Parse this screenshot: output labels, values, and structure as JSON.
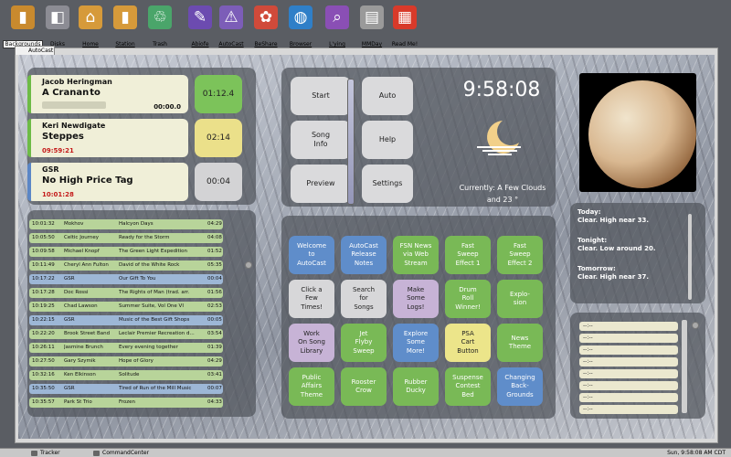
{
  "desktop_icons": [
    {
      "label": "Backgrounds",
      "icon": "folder-icon",
      "color": "#c98a2e",
      "selected": true
    },
    {
      "label": "Disks",
      "icon": "disks-icon",
      "color": "#8c8c94"
    },
    {
      "label": "Home",
      "icon": "home-folder-icon",
      "color": "#d69a3a",
      "underline": true
    },
    {
      "label": "Station",
      "icon": "folder-icon",
      "color": "#d69a3a",
      "underline": true
    },
    {
      "label": "Trash",
      "icon": "trash-icon",
      "color": "#4aa56a"
    },
    {
      "label": "Abiofe",
      "icon": "paint-icon",
      "color": "#6c4bb0",
      "underline": true
    },
    {
      "label": "AutoCast",
      "icon": "broadcast-icon",
      "color": "#7c5db8",
      "underline": true
    },
    {
      "label": "BeShare",
      "icon": "flower-icon",
      "color": "#d04a3a",
      "underline": true
    },
    {
      "label": "Browser",
      "icon": "globe-icon",
      "color": "#2f7fc8",
      "underline": true
    },
    {
      "label": "L'ying",
      "icon": "magnifier-icon",
      "color": "#8a4fb5",
      "underline": true
    },
    {
      "label": "MMDay",
      "icon": "document-icon",
      "color": "#9a9a9a",
      "underline": true
    },
    {
      "label": "Read Me!",
      "icon": "pdf-icon",
      "color": "#d83a2a"
    }
  ],
  "window": {
    "tab_title": "AutoCast"
  },
  "now_playing": [
    {
      "artist": "Jacob Heringman",
      "title": "A Cranan to",
      "time": "00:00.0",
      "countdown": "01:12.4",
      "countdown_color": "#7cc35a",
      "time_red": false,
      "bar_color": "#6dbb46"
    },
    {
      "artist": "Keri Newdigate",
      "title": "Steppes",
      "time": "09:59:21",
      "countdown": "02:14",
      "countdown_color": "#ebe08a",
      "time_red": true,
      "bar_color": "#6dbb46"
    },
    {
      "artist": "GSR",
      "title": "No High Price Tag",
      "time": "10:01:28",
      "countdown": "00:04",
      "countdown_color": "#d3d3d5",
      "time_red": true,
      "bar_color": "#5b86c6"
    }
  ],
  "playlist": [
    {
      "time": "10:01:32",
      "artist": "Mokhov",
      "title": "Halcyon Days",
      "dur": "04:29",
      "color": "green"
    },
    {
      "time": "10:05:50",
      "artist": "Celtic Journey",
      "title": "Ready for the Storm",
      "dur": "04:08",
      "color": "green"
    },
    {
      "time": "10:09:58",
      "artist": "Michael Knopf",
      "title": "The Green Light Expedition",
      "dur": "01:52",
      "color": "green"
    },
    {
      "time": "10:11:49",
      "artist": "Cheryl Ann Fulton",
      "title": "David of the White Rock",
      "dur": "05:35",
      "color": "green"
    },
    {
      "time": "10:17:22",
      "artist": "GSR",
      "title": "Our Gift To You",
      "dur": "00:04",
      "color": "blue"
    },
    {
      "time": "10:17:28",
      "artist": "Doc Rossi",
      "title": "The Rights of Man (trad. arr.",
      "dur": "01:56",
      "color": "green"
    },
    {
      "time": "10:19:25",
      "artist": "Chad Lawson",
      "title": "Summer Suite, Vol One VI",
      "dur": "02:53",
      "color": "green"
    },
    {
      "time": "10:22:15",
      "artist": "GSR",
      "title": "Music of the Best Gift Shops",
      "dur": "00:05",
      "color": "blue"
    },
    {
      "time": "10:22:20",
      "artist": "Brook Street Band",
      "title": "Leclair Premier Recreation d...",
      "dur": "03:54",
      "color": "green"
    },
    {
      "time": "10:26:11",
      "artist": "Jasmine Brunch",
      "title": "Every evening together",
      "dur": "01:39",
      "color": "green"
    },
    {
      "time": "10:27:50",
      "artist": "Gary Szymik",
      "title": "Hope of Glory",
      "dur": "04:29",
      "color": "green"
    },
    {
      "time": "10:32:16",
      "artist": "Ken Elkinson",
      "title": "Solitude",
      "dur": "03:41",
      "color": "green"
    },
    {
      "time": "10:35:50",
      "artist": "GSR",
      "title": "Tired of Run of the Mill Music",
      "dur": "00:07",
      "color": "blue"
    },
    {
      "time": "10:35:57",
      "artist": "Park St Trio",
      "title": "Frozen",
      "dur": "04:33",
      "color": "green"
    }
  ],
  "controls": {
    "start": "Start",
    "song_info": "Song\nInfo",
    "preview": "Preview",
    "auto": "Auto",
    "help": "Help",
    "settings": "Settings"
  },
  "clock": {
    "time": "9:58:08"
  },
  "weather": {
    "current": "Currently: A Few Clouds",
    "temp": "and 23 °"
  },
  "forecast": [
    {
      "label": "Today:",
      "text": "Clear. High near 33."
    },
    {
      "label": "Tonight:",
      "text": "Clear. Low around 20."
    },
    {
      "label": "Tomorrow:",
      "text": "Clear. High near 37."
    }
  ],
  "right_list": [
    "--:--",
    "--:--",
    "--:--",
    "--:--",
    "--:--",
    "--:--",
    "--:--",
    "--:--"
  ],
  "grid_buttons": [
    {
      "label": "Welcome\nto\nAutoCast",
      "style": "gb-blue"
    },
    {
      "label": "AutoCast\nRelease\nNotes",
      "style": "gb-blue"
    },
    {
      "label": "FSN News\nvia Web\nStream",
      "style": "gb-green"
    },
    {
      "label": "Fast\nSweep\nEffect 1",
      "style": "gb-green"
    },
    {
      "label": "Fast\nSweep\nEffect 2",
      "style": "gb-green"
    },
    {
      "label": "Click a\nFew\nTimes!",
      "style": "gb-grey"
    },
    {
      "label": "Search\nfor\nSongs",
      "style": "gb-grey"
    },
    {
      "label": "Make\nSome\nLogs!",
      "style": "gb-lav"
    },
    {
      "label": "Drum\nRoll\nWinner!",
      "style": "gb-green"
    },
    {
      "label": "Explo-\nsion",
      "style": "gb-green"
    },
    {
      "label": "Work\nOn Song\nLibrary",
      "style": "gb-lav"
    },
    {
      "label": "Jet\nFlyby\nSweep",
      "style": "gb-green"
    },
    {
      "label": "Explore\nSome\nMore!",
      "style": "gb-blue"
    },
    {
      "label": "PSA\nCart\nButton",
      "style": "gb-yel"
    },
    {
      "label": "News\nTheme",
      "style": "gb-green"
    },
    {
      "label": "Public\nAffairs\nTheme",
      "style": "gb-green"
    },
    {
      "label": "Rooster\nCrow",
      "style": "gb-green"
    },
    {
      "label": "Rubber\nDucky",
      "style": "gb-green"
    },
    {
      "label": "Suspense\nContest\nBed",
      "style": "gb-green"
    },
    {
      "label": "Changing\nBack-\nGrounds",
      "style": "gb-blue"
    }
  ],
  "taskbar": {
    "items": [
      "Tracker",
      "CommandCenter"
    ],
    "clock": "Sun, 9:58:08 AM CDT"
  }
}
